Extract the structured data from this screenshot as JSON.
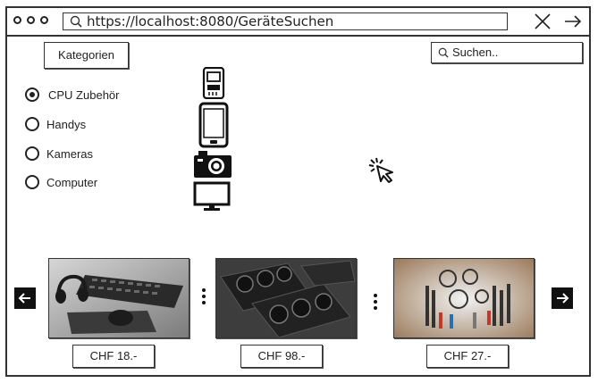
{
  "browser": {
    "url": "https://localhost:8080/GeräteSuchen"
  },
  "header": {
    "category_button_label": "Kategorien",
    "search_placeholder": "Suchen.."
  },
  "filters": [
    {
      "label": "CPU Zubehör",
      "checked": true,
      "icon": "cpu-chip-icon"
    },
    {
      "label": "Handys",
      "checked": false,
      "icon": "smartphone-icon"
    },
    {
      "label": "Kameras",
      "checked": false,
      "icon": "camera-icon"
    },
    {
      "label": "Computer",
      "checked": false,
      "icon": "monitor-icon"
    }
  ],
  "products": [
    {
      "image": "keyboard-headset-mouse-image",
      "price": "CHF 18.-"
    },
    {
      "image": "graphics-cards-image",
      "price": "CHF 98.-"
    },
    {
      "image": "cables-adapters-image",
      "price": "CHF 27.-"
    }
  ],
  "carousel": {
    "prev_icon": "arrow-left-icon",
    "next_icon": "arrow-right-icon"
  }
}
